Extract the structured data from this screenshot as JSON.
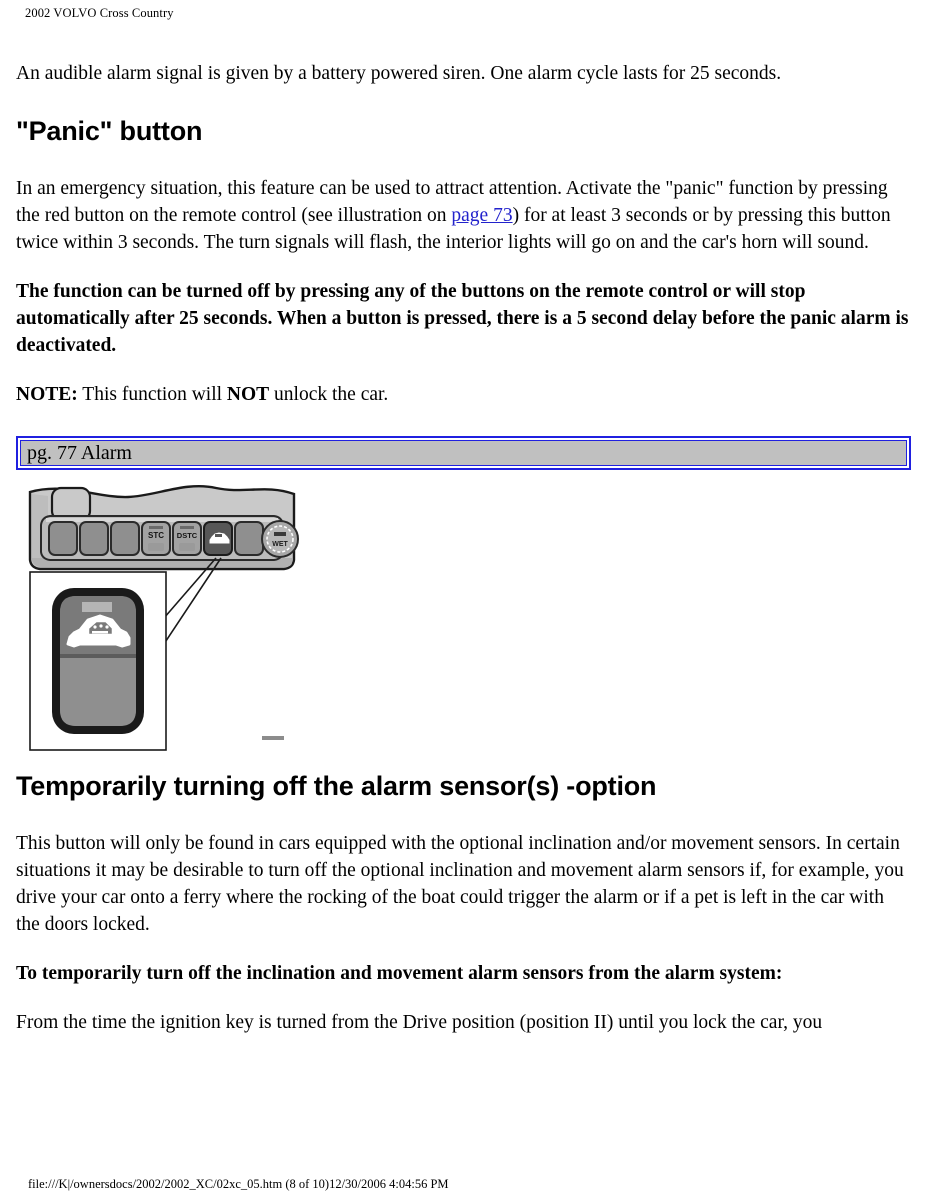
{
  "header": {
    "running_title": "2002 VOLVO Cross Country"
  },
  "content": {
    "intro_paragraph": "An audible alarm signal is given by a battery powered siren. One alarm cycle lasts for 25 seconds.",
    "panic_heading": "\"Panic\" button",
    "panic_paragraph_part1": "In an emergency situation, this feature can be used to attract attention. Activate the \"panic\" function by pressing the red button on the remote control (see illustration on ",
    "panic_link_label": "page 73",
    "panic_paragraph_part2": ") for at least 3 seconds or by pressing this button twice within 3 seconds. The turn signals will flash, the interior lights will go on and the car's horn will sound.",
    "turn_off_bold_paragraph": "The function can be turned off by pressing any of the buttons on the remote control or will stop automatically after 25 seconds. When a button is pressed, there is a 5 second delay before the panic alarm is deactivated.",
    "note_label": "NOTE:",
    "note_text_part1": " This function will ",
    "note_emphasis": "NOT",
    "note_text_part2": " unlock the car.",
    "caption_bar_text": "pg. 77 Alarm",
    "sensor_heading": "Temporarily turning off the alarm sensor(s) -option",
    "sensor_paragraph": "This button will only be found in cars equipped with the optional inclination and/or movement sensors. In certain situations it may be desirable to turn off the optional inclination and movement alarm sensors if, for example, you drive your car onto a ferry where the rocking of the boat could trigger the alarm or if a pet is left in the car with the doors locked.",
    "sensor_bold_lead": "To temporarily turn off the inclination and movement alarm sensors from the alarm system:",
    "final_paragraph": "From the time the ignition key is turned from the Drive position (position II) until you lock the car, you"
  },
  "figure": {
    "alt": "Center console switch panel with alarm sensor button detail",
    "console_button_labels": [
      "",
      "",
      "",
      "STC",
      "DSTC",
      "",
      ""
    ],
    "knob_label": "WET",
    "detail_callout": "alarm-sensor-button-detail"
  },
  "colors": {
    "link": "#2222cc",
    "caption_border": "#2020e0",
    "caption_fill": "#c0c0c0",
    "console_body": "#c8c8c8",
    "console_body_dark": "#a8a8a8",
    "button_face": "#909090",
    "button_active": "#585858",
    "page_bg": "#ffffff",
    "text": "#000000"
  },
  "footer": {
    "path_text": "file:///K|/ownersdocs/2002/2002_XC/02xc_05.htm (8 of 10)12/30/2006 4:04:56 PM"
  }
}
